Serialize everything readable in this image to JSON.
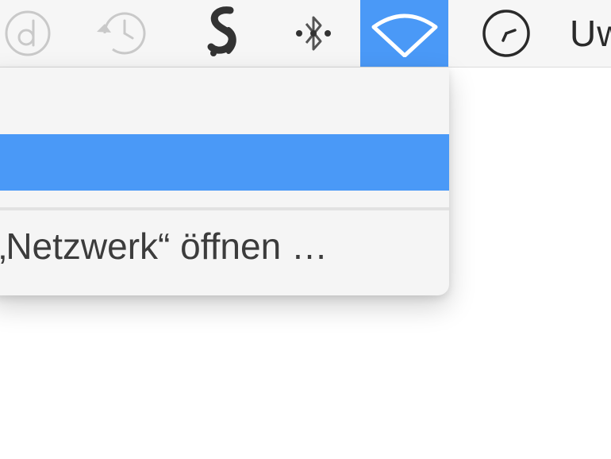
{
  "menubar": {
    "icons": [
      {
        "name": "d-circle-icon"
      },
      {
        "name": "time-machine-icon"
      },
      {
        "name": "script-s-icon"
      },
      {
        "name": "bluetooth-icon"
      },
      {
        "name": "wifi-icon",
        "active": true
      },
      {
        "name": "clock-icon"
      }
    ],
    "user_label": "Uw"
  },
  "wifi_menu": {
    "open_network_label": "„Netzwerk“ öffnen …"
  },
  "colors": {
    "menubar_bg": "#f6f6f6",
    "highlight": "#4a99f7",
    "menu_bg": "#f5f5f5",
    "text": "#3c3c3c"
  }
}
